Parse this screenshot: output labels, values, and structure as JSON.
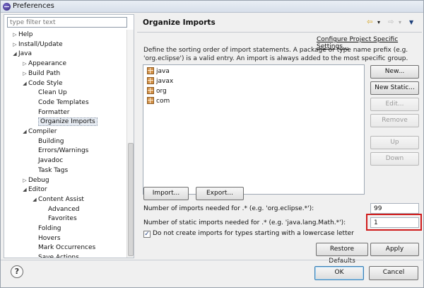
{
  "window": {
    "title": "Preferences"
  },
  "sidebar": {
    "filter_placeholder": "type filter text",
    "tree": [
      {
        "label": "Help",
        "twisty": "▷"
      },
      {
        "label": "Install/Update",
        "twisty": "▷"
      },
      {
        "label": "Java",
        "twisty": "◢"
      },
      {
        "label": "Appearance",
        "twisty": "▷"
      },
      {
        "label": "Build Path",
        "twisty": "▷"
      },
      {
        "label": "Code Style",
        "twisty": "◢"
      },
      {
        "label": "Clean Up",
        "twisty": ""
      },
      {
        "label": "Code Templates",
        "twisty": ""
      },
      {
        "label": "Formatter",
        "twisty": ""
      },
      {
        "label": "Organize Imports",
        "twisty": ""
      },
      {
        "label": "Compiler",
        "twisty": "◢"
      },
      {
        "label": "Building",
        "twisty": ""
      },
      {
        "label": "Errors/Warnings",
        "twisty": ""
      },
      {
        "label": "Javadoc",
        "twisty": ""
      },
      {
        "label": "Task Tags",
        "twisty": ""
      },
      {
        "label": "Debug",
        "twisty": "▷"
      },
      {
        "label": "Editor",
        "twisty": "◢"
      },
      {
        "label": "Content Assist",
        "twisty": "◢"
      },
      {
        "label": "Advanced",
        "twisty": ""
      },
      {
        "label": "Favorites",
        "twisty": ""
      },
      {
        "label": "Folding",
        "twisty": ""
      },
      {
        "label": "Hovers",
        "twisty": ""
      },
      {
        "label": "Mark Occurrences",
        "twisty": ""
      },
      {
        "label": "Save Actions",
        "twisty": ""
      }
    ]
  },
  "page": {
    "title": "Organize Imports",
    "configure_link": "Configure Project Specific Settings...",
    "description": "Define the sorting order of import statements. A package or type name prefix (e.g. 'org.eclipse') is a valid entry. An import is always added to the most specific group.",
    "imports": [
      "java",
      "javax",
      "org",
      "com"
    ],
    "buttons": {
      "new": "New...",
      "new_static": "New Static...",
      "edit": "Edit...",
      "remove": "Remove",
      "up": "Up",
      "down": "Down",
      "import": "Import...",
      "export": "Export..."
    },
    "imports_threshold_label": "Number of imports needed for .* (e.g. 'org.eclipse.*'):",
    "imports_threshold_value": "99",
    "static_threshold_label": "Number of static imports needed for .* (e.g. 'java.lang.Math.*'):",
    "static_threshold_value": "1",
    "lowercase_check_label": "Do not create imports for types starting with a lowercase letter",
    "lowercase_checked": true,
    "restore_defaults": "Restore Defaults",
    "apply": "Apply"
  },
  "footer": {
    "help_glyph": "?",
    "ok": "OK",
    "cancel": "Cancel"
  },
  "nav": {
    "back": "⇦",
    "back_menu": "▾",
    "forward": "⇨",
    "forward_menu": "▾",
    "view_menu": "▼"
  }
}
